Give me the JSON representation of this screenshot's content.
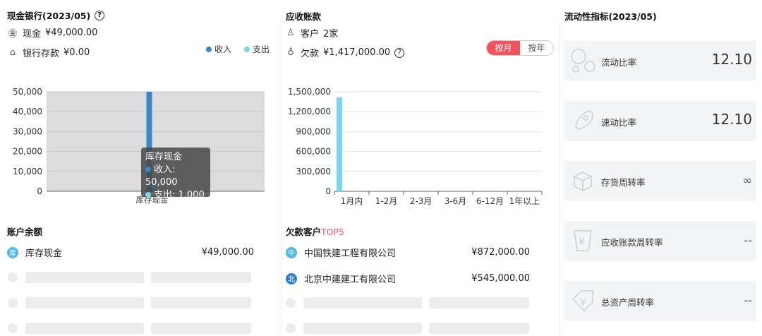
{
  "cash_bank": {
    "title": "现金银行(2023/05)",
    "cash_label": "现金",
    "cash_value": "¥49,000.00",
    "deposit_label": "银行存款",
    "deposit_value": "¥0.00",
    "legend": [
      "收入",
      "支出"
    ],
    "tooltip": {
      "title": "库存现金",
      "income": "收入: 50,000",
      "expense": "支出: 1,000"
    }
  },
  "receivables": {
    "title": "应收账款",
    "customers_label": "客户",
    "customers_value": "2家",
    "debt_label": "欠款",
    "debt_value": "¥1,417,000.00",
    "toggle_month": "按月",
    "toggle_year": "按年"
  },
  "account_balance": {
    "title": "账户余额",
    "items": [
      {
        "badge": "库",
        "name": "库存现金",
        "amount": "¥49,000.00"
      }
    ]
  },
  "top_debtors": {
    "title_prefix": "欠款客户",
    "title_suffix": "TOP5",
    "items": [
      {
        "badge": "中",
        "name": "中国铁建工程有限公司",
        "amount": "¥872,000.00"
      },
      {
        "badge": "北",
        "name": "北京中建建工有限公司",
        "amount": "¥545,000.00"
      }
    ]
  },
  "liquidity": {
    "title": "流动性指标(2023/05)",
    "metrics": [
      {
        "label": "流动比率",
        "value": "12.10"
      },
      {
        "label": "速动比率",
        "value": "12.10"
      },
      {
        "label": "存货周转率",
        "value": "∞"
      },
      {
        "label": "应收账款周转率",
        "value": "--"
      },
      {
        "label": "总资产周转率",
        "value": "--"
      }
    ]
  },
  "colors": {
    "income": "#3b86c6",
    "expense": "#79d6ee",
    "accent_red": "#f2535b",
    "badge_blue": "#2f7fd1",
    "badge_cyan": "#4fb8e6"
  },
  "chart_data": [
    {
      "type": "bar",
      "categories": [
        "库存现金"
      ],
      "series": [
        {
          "name": "收入",
          "values": [
            50000
          ]
        },
        {
          "name": "支出",
          "values": [
            1000
          ]
        }
      ],
      "yticks": [
        "0",
        "10,000",
        "20,000",
        "30,000",
        "40,000",
        "50,000"
      ],
      "ylim": [
        0,
        50000
      ],
      "grid": true,
      "legend": "top-right"
    },
    {
      "type": "bar",
      "categories": [
        "1月内",
        "1-2月",
        "2-3月",
        "3-6月",
        "6-12月",
        "1年以上"
      ],
      "values": [
        1417000,
        0,
        0,
        0,
        0,
        0
      ],
      "yticks": [
        "0",
        "300,000",
        "600,000",
        "900,000",
        "1,200,000",
        "1,500,000"
      ],
      "ylim": [
        0,
        1500000
      ],
      "grid": true
    }
  ]
}
